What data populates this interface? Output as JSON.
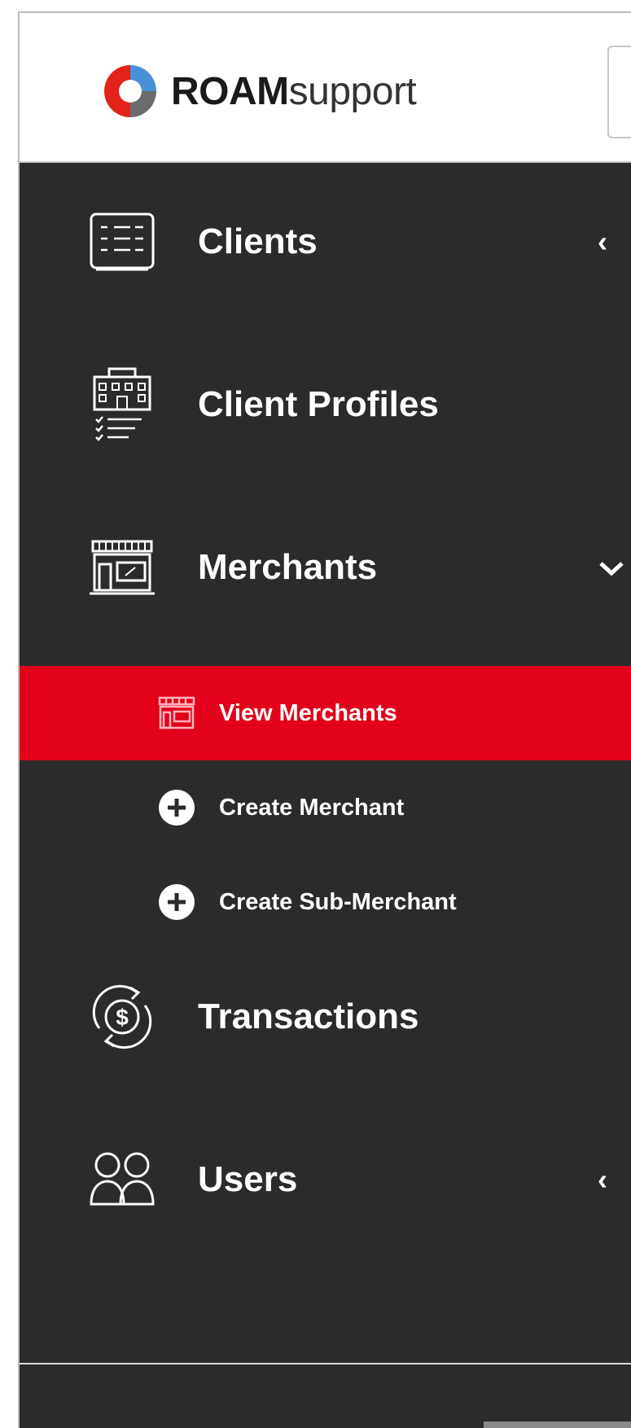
{
  "brand": {
    "bold": "ROAM",
    "light": "support"
  },
  "colors": {
    "sidebar_bg": "#2b2b2b",
    "active_bg": "#e2001a",
    "text": "#ffffff"
  },
  "sidebar": {
    "items": [
      {
        "label": "Clients",
        "icon": "clients-list-icon",
        "chevron": "‹"
      },
      {
        "label": "Client Profiles",
        "icon": "building-checklist-icon"
      },
      {
        "label": "Merchants",
        "icon": "storefront-icon",
        "chevron": "⌄",
        "expanded": true
      },
      {
        "label": "Transactions",
        "icon": "dollar-cycle-icon"
      },
      {
        "label": "Users",
        "icon": "users-icon",
        "chevron": "‹"
      }
    ],
    "merchants_sub": [
      {
        "label": "View Merchants",
        "icon": "storefront-icon",
        "active": true
      },
      {
        "label": "Create Merchant",
        "icon": "plus-circle-icon"
      },
      {
        "label": "Create Sub-Merchant",
        "icon": "plus-circle-icon"
      }
    ]
  }
}
